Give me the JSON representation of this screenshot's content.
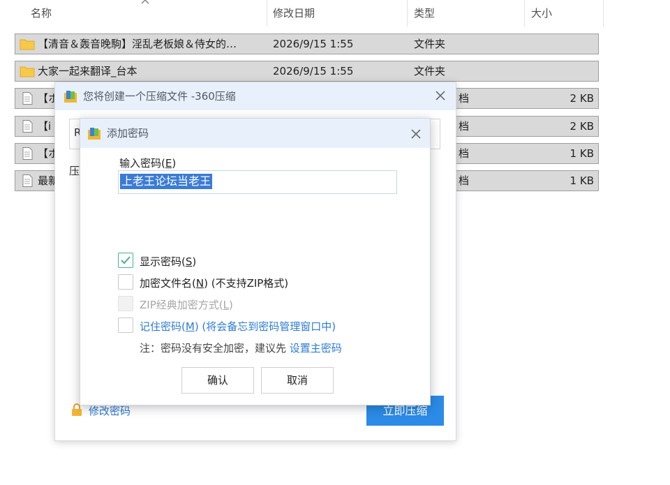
{
  "explorer": {
    "columns": {
      "name": "名称",
      "date": "修改日期",
      "type": "类型",
      "size": "大小"
    },
    "rows": [
      {
        "name": "【清音＆轰音晚駒】淫乱老板娘＆侍女的…",
        "date": "2026/9/15 1:55",
        "type": "文件夹",
        "size": "",
        "icon": "folder-icon"
      },
      {
        "name": "大家一起来翻译_台本",
        "date": "2026/9/15 1:55",
        "type": "文件夹",
        "size": "",
        "icon": "folder-icon"
      },
      {
        "name": "【ホ",
        "date": "",
        "type": "档",
        "size": "2 KB",
        "icon": "file-icon"
      },
      {
        "name": "【i",
        "date": "",
        "type": "档",
        "size": "2 KB",
        "icon": "file-icon"
      },
      {
        "name": "【ホ",
        "date": "",
        "type": "档",
        "size": "1 KB",
        "icon": "file-icon"
      },
      {
        "name": "最新",
        "date": "",
        "type": "档",
        "size": "1 KB",
        "icon": "file-icon"
      }
    ]
  },
  "compress_window": {
    "title": "您将创建一个压缩文件 -360压缩",
    "path_field_prefix": "R",
    "side_label": "压",
    "modify_password": "修改密码",
    "compress_now": "立即压缩"
  },
  "password_dialog": {
    "title": "添加密码",
    "input_label": "输入密码(",
    "input_label_key": "E",
    "input_label_end": ")",
    "password_value": "上老王论坛当老王",
    "options": {
      "show_password": {
        "label": "显示密码(",
        "key": "S",
        "end": ")",
        "checked": true
      },
      "encrypt_filenames": {
        "label": "加密文件名(",
        "key": "N",
        "end": ") (不支持ZIP格式)",
        "checked": false
      },
      "zip_classic": {
        "label": "ZIP经典加密方式(",
        "key": "L",
        "end": ")",
        "checked": false,
        "disabled": true
      },
      "remember_password": {
        "label": "记住密码(",
        "key": "M",
        "end": ") (将会备忘到密码管理窗口中)",
        "checked": false
      }
    },
    "note_prefix": "注：密码没有安全加密，建议先 ",
    "note_link": "设置主密码",
    "ok_button": "确认",
    "cancel_button": "取消"
  },
  "colors": {
    "accent": "#2b8be6",
    "titlebar": "#e8f1fb",
    "selection": "#3a7bd5",
    "check_green": "#49b28b",
    "link_blue": "#2c7bd4"
  }
}
